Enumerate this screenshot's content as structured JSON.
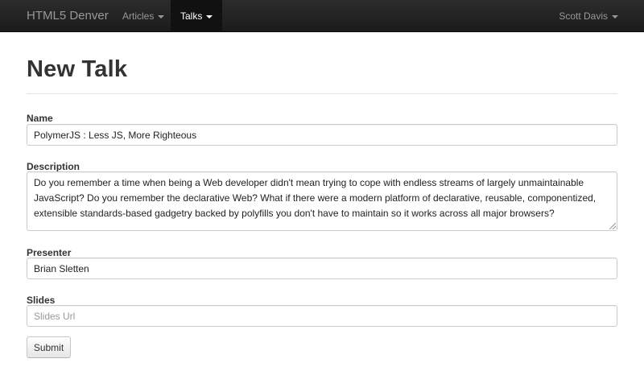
{
  "navbar": {
    "brand": "HTML5 Denver",
    "items": [
      {
        "label": "Articles",
        "active": false
      },
      {
        "label": "Talks",
        "active": true
      }
    ],
    "user": "Scott Davis"
  },
  "page": {
    "title": "New Talk"
  },
  "form": {
    "name": {
      "label": "Name",
      "value": "PolymerJS : Less JS, More Righteous"
    },
    "description": {
      "label": "Description",
      "value": "Do you remember a time when being a Web developer didn't mean trying to cope with endless streams of largely unmaintainable JavaScript? Do you remember the declarative Web? What if there were a modern platform of declarative, reusable, componentized, extensible standards-based gadgetry backed by polyfills you don't have to maintain so it works across all major browsers?"
    },
    "presenter": {
      "label": "Presenter",
      "value": "Brian Sletten"
    },
    "slides": {
      "label": "Slides",
      "value": "",
      "placeholder": "Slides Url"
    },
    "submit_label": "Submit"
  },
  "colors": {
    "navbar_bg": "#222222",
    "navbar_active_bg": "#111111",
    "navbar_text": "#999999"
  }
}
